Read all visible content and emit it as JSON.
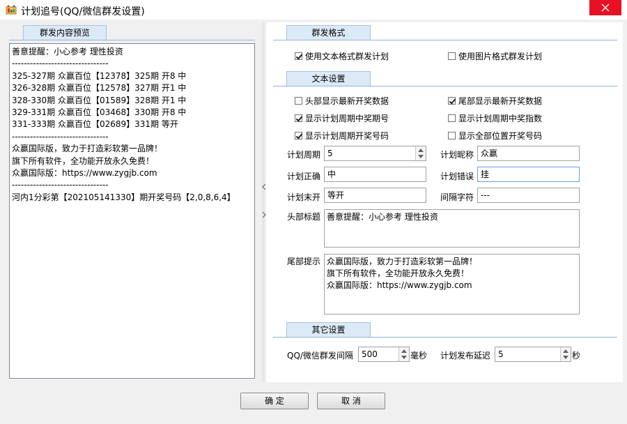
{
  "window": {
    "title": "计划追号(QQ/微信群发设置)"
  },
  "preview": {
    "tab_label": "群发内容预览",
    "lines": [
      "善意提醒：小心参考   理性投资",
      "--------------------------------",
      "325-327期 众赢百位【12378】325期 开8 中",
      "326-328期 众赢百位【12578】327期 开1 中",
      "328-330期 众赢百位【01589】328期 开1 中",
      "329-331期 众赢百位【03468】330期 开8 中",
      "331-333期 众赢百位【02689】331期 等开",
      "--------------------------------",
      "众赢国际版，致力于打造彩软第一品牌！",
      "旗下所有软件，全功能开放永久免费！",
      "众赢国际版：https://www.zygjb.com",
      "--------------------------------",
      "河内1分彩第【202105141330】期开奖号码【2,0,8,6,4】"
    ]
  },
  "format": {
    "section_label": "群发格式",
    "text_format_label": "使用文本格式群发计划",
    "text_format_checked": true,
    "image_format_label": "使用图片格式群发计划",
    "image_format_checked": false
  },
  "text_settings": {
    "section_label": "文本设置",
    "options": [
      {
        "label": "头部显示最新开奖数据",
        "checked": false
      },
      {
        "label": "尾部显示最新开奖数据",
        "checked": true
      },
      {
        "label": "显示计划周期中奖期号",
        "checked": true
      },
      {
        "label": "显示计划周期中奖指数",
        "checked": false
      },
      {
        "label": "显示计划周期开奖号码",
        "checked": true
      },
      {
        "label": "显示全部位置开奖号码",
        "checked": false
      }
    ],
    "fields": {
      "cycle_label": "计划周期",
      "cycle_value": "5",
      "nickname_label": "计划昵称",
      "nickname_value": "众赢",
      "correct_label": "计划正确",
      "correct_value": "中",
      "wrong_label": "计划错误",
      "wrong_value": "挂",
      "pending_label": "计划末开",
      "pending_value": "等开",
      "separator_label": "间隔字符",
      "separator_value": "---"
    },
    "header_title_label": "头部标题",
    "header_title_lines": [
      "善意提醒：小心参考   理性投资"
    ],
    "footer_label": "尾部提示",
    "footer_lines": [
      "众赢国际版，致力于打造彩软第一品牌！",
      "旗下所有软件，全功能开放永久免费！",
      "众赢国际版：https://www.zygjb.com"
    ]
  },
  "other_settings": {
    "section_label": "其它设置",
    "interval_label": "QQ/微信群发间隔",
    "interval_value": "500",
    "interval_unit": "毫秒",
    "delay_label": "计划发布延迟",
    "delay_value": "5",
    "delay_unit": "秒"
  },
  "buttons": {
    "ok_label": "确  定",
    "cancel_label": "取  消"
  },
  "colors": {
    "close_button": "#e81123",
    "section_tab": "#dce9f7"
  }
}
